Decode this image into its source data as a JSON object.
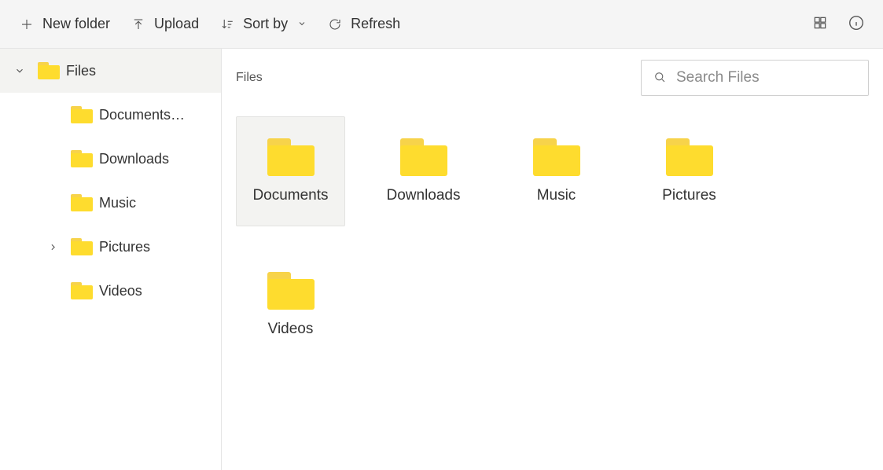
{
  "toolbar": {
    "new_folder_label": "New folder",
    "upload_label": "Upload",
    "sort_by_label": "Sort by",
    "refresh_label": "Refresh"
  },
  "sidebar": {
    "root_label": "Files",
    "items": [
      {
        "label": "Documents…",
        "expandable": false
      },
      {
        "label": "Downloads",
        "expandable": false
      },
      {
        "label": "Music",
        "expandable": false
      },
      {
        "label": "Pictures",
        "expandable": true
      },
      {
        "label": "Videos",
        "expandable": false
      }
    ]
  },
  "main": {
    "breadcrumb": "Files",
    "search_placeholder": "Search Files",
    "items": [
      {
        "label": "Documents",
        "selected": true
      },
      {
        "label": "Downloads",
        "selected": false
      },
      {
        "label": "Music",
        "selected": false
      },
      {
        "label": "Pictures",
        "selected": false
      },
      {
        "label": "Videos",
        "selected": false
      }
    ]
  }
}
